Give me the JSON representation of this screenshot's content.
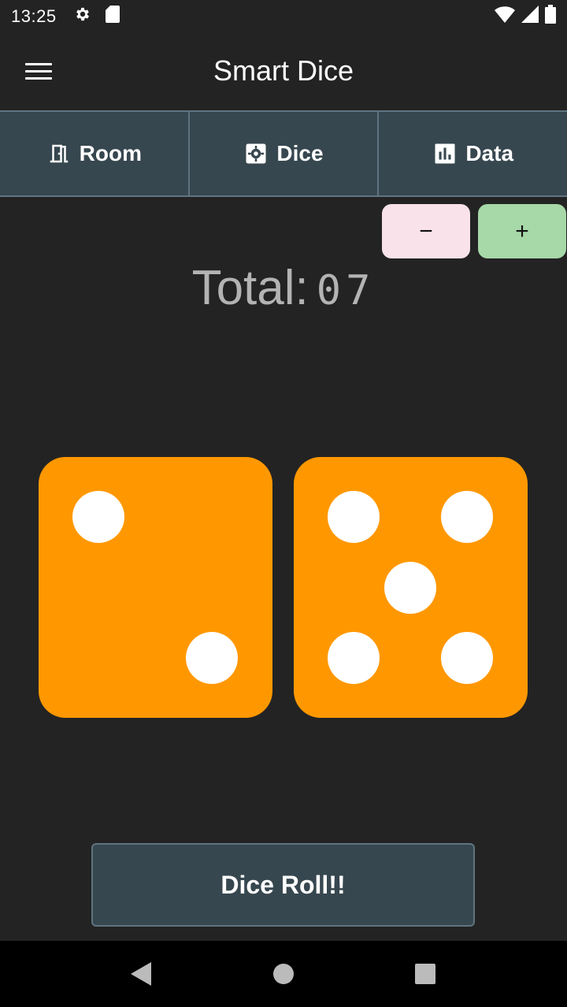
{
  "status_bar": {
    "time": "13:25",
    "icons_left": [
      "gear-icon",
      "sd-card-icon"
    ],
    "icons_right": [
      "wifi-icon",
      "signal-icon",
      "battery-icon"
    ]
  },
  "app_bar": {
    "title": "Smart Dice",
    "menu_icon": "hamburger-menu-icon"
  },
  "tabs": [
    {
      "label": "Room",
      "icon": "door-icon"
    },
    {
      "label": "Dice",
      "icon": "settings-box-icon"
    },
    {
      "label": "Data",
      "icon": "bar-chart-icon"
    }
  ],
  "stepper": {
    "minus_label": "−",
    "plus_label": "+",
    "minus_color": "#fae2ea",
    "plus_color": "#a7d8a8"
  },
  "total": {
    "label": "Total:",
    "value": "07"
  },
  "dice": [
    {
      "value": 2,
      "color": "#ff9800"
    },
    {
      "value": 5,
      "color": "#ff9800"
    }
  ],
  "roll_button": {
    "label": "Dice Roll!!"
  },
  "nav_bar": {
    "buttons": [
      "back-icon",
      "home-icon",
      "recents-icon"
    ]
  }
}
